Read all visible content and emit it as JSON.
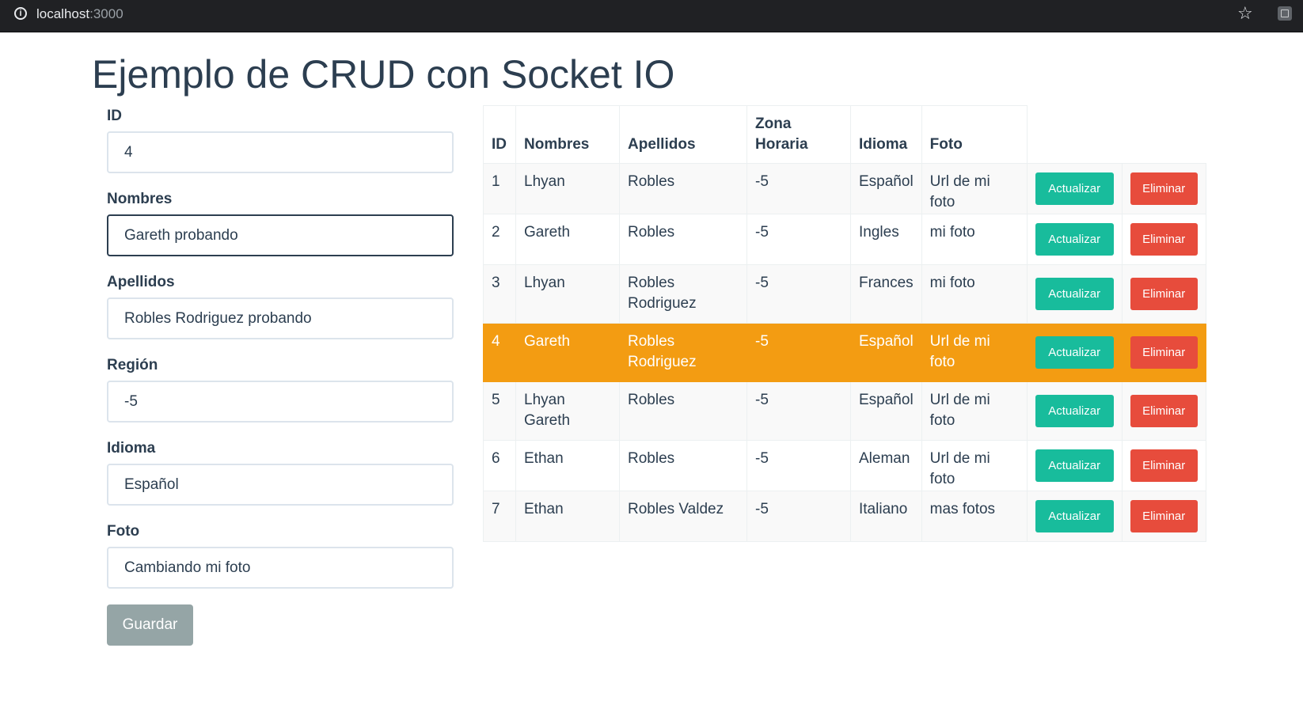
{
  "browser": {
    "url_host": "localhost",
    "url_port": ":3000"
  },
  "page": {
    "title": "Ejemplo de CRUD con Socket IO"
  },
  "form": {
    "fields": [
      {
        "label": "ID",
        "value": "4"
      },
      {
        "label": "Nombres",
        "value": "Gareth probando"
      },
      {
        "label": "Apellidos",
        "value": "Robles Rodriguez probando"
      },
      {
        "label": "Región",
        "value": "-5"
      },
      {
        "label": "Idioma",
        "value": "Español"
      },
      {
        "label": "Foto",
        "value": "Cambiando mi foto"
      }
    ],
    "save_label": "Guardar"
  },
  "table": {
    "headers": [
      "ID",
      "Nombres",
      "Apellidos",
      "Zona\nHoraria",
      "Idioma",
      "Foto"
    ],
    "update_label": "Actualizar",
    "delete_label": "Eliminar",
    "selected_row": 3,
    "rows": [
      [
        "1",
        "Lhyan",
        "Robles",
        "-5",
        "Español",
        "Url de mi foto"
      ],
      [
        "2",
        "Gareth",
        "Robles",
        "-5",
        "Ingles",
        "mi foto"
      ],
      [
        "3",
        "Lhyan",
        "Robles Rodriguez",
        "-5",
        "Frances",
        "mi foto"
      ],
      [
        "4",
        "Gareth",
        "Robles Rodriguez",
        "-5",
        "Español",
        "Url de mi foto"
      ],
      [
        "5",
        "Lhyan Gareth",
        "Robles",
        "-5",
        "Español",
        "Url de mi foto"
      ],
      [
        "6",
        "Ethan",
        "Robles",
        "-5",
        "Aleman",
        "Url de mi foto"
      ],
      [
        "7",
        "Ethan",
        "Robles Valdez",
        "-5",
        "Italiano",
        "mas fotos"
      ]
    ]
  },
  "colors": {
    "primary": "#2c3e50",
    "success": "#18bc9c",
    "danger": "#e74c3c",
    "warning": "#f39c12",
    "secondary": "#95a5a6"
  }
}
